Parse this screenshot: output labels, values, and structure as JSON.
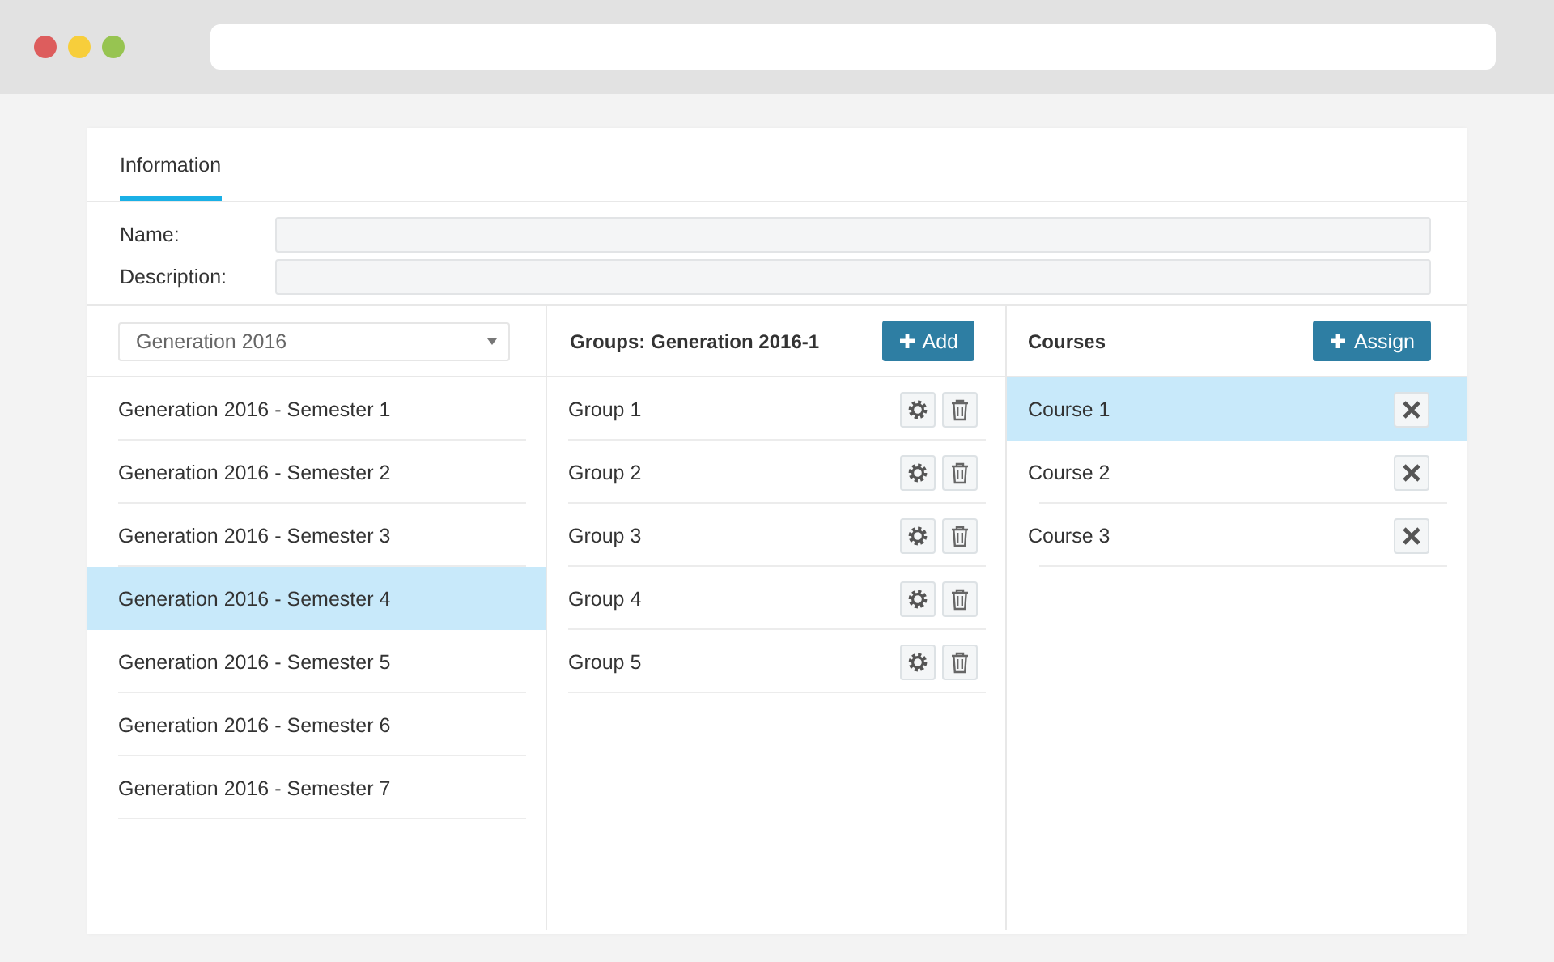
{
  "tabs": [
    {
      "label": "Information",
      "selected": true
    }
  ],
  "fields": [
    {
      "label": "Name:"
    },
    {
      "label": "Description:"
    }
  ],
  "generations": {
    "dropdown": "Generation 2016",
    "items": [
      {
        "label": "Generation 2016 - Semester 1",
        "selected": false
      },
      {
        "label": "Generation 2016 - Semester 2",
        "selected": false
      },
      {
        "label": "Generation 2016 - Semester 3",
        "selected": false
      },
      {
        "label": "Generation 2016 - Semester 4",
        "selected": true
      },
      {
        "label": "Generation 2016 - Semester 5",
        "selected": false
      },
      {
        "label": "Generation 2016 - Semester 6",
        "selected": false
      },
      {
        "label": "Generation 2016 - Semester 7",
        "selected": false
      }
    ]
  },
  "groups": {
    "title": "Groups: Generation 2016-1",
    "button": "Add",
    "items": [
      {
        "label": "Group 1",
        "selected": false
      },
      {
        "label": "Group 2",
        "selected": false
      },
      {
        "label": "Group 3",
        "selected": false
      },
      {
        "label": "Group 4",
        "selected": false
      },
      {
        "label": "Group 5",
        "selected": false
      }
    ]
  },
  "courses": {
    "title": "Courses",
    "button": "Assign",
    "items": [
      {
        "label": "Course 1",
        "selected": true
      },
      {
        "label": "Course 2",
        "selected": false
      },
      {
        "label": "Course 3",
        "selected": false
      }
    ]
  }
}
